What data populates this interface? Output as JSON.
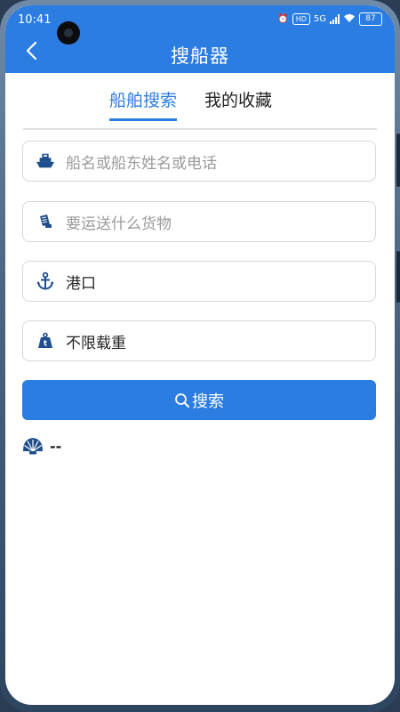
{
  "status_bar": {
    "time": "10:41",
    "network": "5G",
    "hd": "HD",
    "battery": "87"
  },
  "header": {
    "title": "搜船器"
  },
  "tabs": [
    {
      "label": "船舶搜索",
      "active": true
    },
    {
      "label": "我的收藏",
      "active": false
    }
  ],
  "form": {
    "ship_name_placeholder": "船名或船东姓名或电话",
    "cargo_placeholder": "要运送什么货物",
    "port_placeholder": "港口",
    "tonnage_value": "不限载重",
    "search_label": "搜索"
  },
  "result": {
    "text": "--"
  },
  "icons": {
    "back": "chevron-left-icon",
    "ship": "ship-icon",
    "cargo": "cargo-icon",
    "port": "anchor-icon",
    "weight": "weight-icon",
    "search": "search-icon",
    "result": "shell-icon"
  },
  "colors": {
    "accent": "#2b7de1",
    "icon": "#1f4e8c"
  }
}
